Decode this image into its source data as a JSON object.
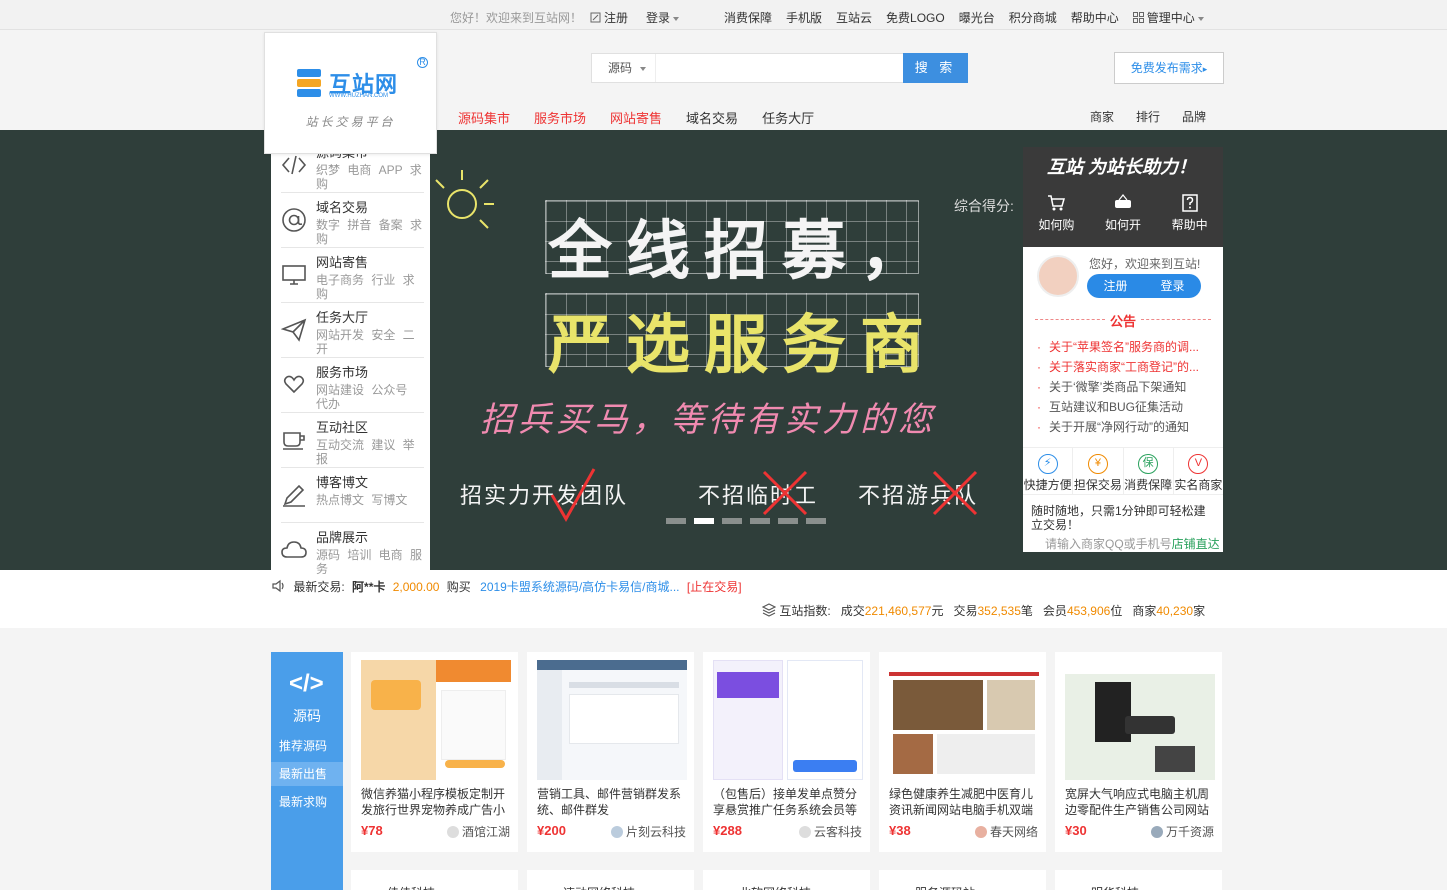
{
  "topbar": {
    "welcome": "您好！欢迎来到互站网！",
    "register": "注册",
    "login": "登录",
    "links": [
      "消费保障",
      "手机版",
      "互站云",
      "免费LOGO",
      "曝光台",
      "积分商城",
      "帮助中心",
      "管理中心"
    ]
  },
  "logo": {
    "name": "互站网",
    "url": "WWW.HUZHAN.COM",
    "reg": "R",
    "slogan": "站长交易平台"
  },
  "search": {
    "type": "源码",
    "placeholder": "",
    "button": "搜 索"
  },
  "publish_button": "免费发布需求",
  "mainnav": [
    "源码集市",
    "服务市场",
    "网站寄售",
    "域名交易",
    "任务大厅"
  ],
  "subnav": [
    "商家",
    "排行",
    "品牌"
  ],
  "categories": [
    {
      "title": "源码集市",
      "tags": "织梦 电商 APP 求购",
      "icon": "code-icon"
    },
    {
      "title": "域名交易",
      "tags": "数字 拼音 备案 求购",
      "icon": "at-icon"
    },
    {
      "title": "网站寄售",
      "tags": "电子商务 行业 求购",
      "icon": "monitor-icon"
    },
    {
      "title": "任务大厅",
      "tags": "网站开发 安全 二开",
      "icon": "paper-plane-icon"
    },
    {
      "title": "服务市场",
      "tags": "网站建设 公众号 代办",
      "icon": "heart-hands-icon"
    },
    {
      "title": "互动社区",
      "tags": "互动交流 建议 举报",
      "icon": "cup-icon"
    },
    {
      "title": "博客博文",
      "tags": "热点博文 写博文",
      "icon": "pen-icon"
    },
    {
      "title": "品牌展示",
      "tags": "源码 培训 电商 服务",
      "icon": "cloud-icon"
    }
  ],
  "banner": {
    "line1": "全线招募，",
    "line2": "严选服务商",
    "line3": "招兵买马，等待有实力的您",
    "items": [
      "招实力开发团队",
      "不招临时工",
      "不招游兵队"
    ],
    "score_label": "综合得分:",
    "dots": 6,
    "active_dot": 1
  },
  "rpanel": {
    "slogan": "互站 为站长助力！",
    "links": [
      "如何购",
      "如何开",
      "帮助中"
    ],
    "hello": "您好，欢迎来到互站!",
    "register": "注册",
    "login": "登录",
    "notice_title": "公告",
    "notices": [
      {
        "text": "关于“苹果签名”服务商的调...",
        "hot": true
      },
      {
        "text": "关于落实商家“工商登记”的...",
        "hot": true
      },
      {
        "text": "关于‘微擎’类商品下架通知",
        "hot": false
      },
      {
        "text": "互站建议和BUG征集活动",
        "hot": false
      },
      {
        "text": "关于开展“净网行动”的通知",
        "hot": false
      }
    ],
    "services": [
      {
        "label": "快捷方便",
        "glyph": "⚡",
        "color": "#2d8ee8"
      },
      {
        "label": "担保交易",
        "glyph": "¥",
        "color": "#f08a00"
      },
      {
        "label": "消费保障",
        "glyph": "保",
        "color": "#2aa15d"
      },
      {
        "label": "实名商家",
        "glyph": "V",
        "color": "#e33"
      }
    ],
    "desc": "随时随地，只需1分钟即可轻松建立交易！",
    "desc2_a": "请输入商家QQ或手机号",
    "desc2_b": "店铺直达"
  },
  "ticker": {
    "label": "最新交易:",
    "buyer": "阿**卡",
    "price": "2,000.00",
    "action": "购买",
    "item": "2019卡盟系统源码/高仿卡易信/商城...",
    "status": "[止在交易]",
    "index_label": "互站指数:",
    "deals_label": "成交",
    "deals": "221,460,577",
    "deals_unit": "元",
    "trades_label": "交易",
    "trades": "352,535",
    "trades_unit": "笔",
    "members_label": "会员",
    "members": "453,906",
    "members_unit": "位",
    "shops_label": "商家",
    "shops": "40,230",
    "shops_unit": "家"
  },
  "side_card": {
    "title": "源码",
    "links": [
      "推荐源码",
      "最新出售",
      "最新求购"
    ],
    "active": 1
  },
  "products": [
    {
      "name": "微信养猫小程序模板定制开发旅行世界宠物养成广告小",
      "price": "¥78",
      "shop": "酒馆江湖"
    },
    {
      "name": "营销工具、邮件营销群发系统、邮件群发",
      "price": "¥200",
      "shop": "片刻云科技"
    },
    {
      "name": "（包售后）接单发单点赞分享悬赏推广任务系统会员等",
      "price": "¥288",
      "shop": "云客科技"
    },
    {
      "name": "绿色健康养生减肥中医育儿资讯新闻网站电脑手机双端",
      "price": "¥38",
      "shop": "春天网络"
    },
    {
      "name": "宽屏大气响应式电脑主机周边零配件生产销售公司网站",
      "price": "¥30",
      "shop": "万千资源"
    }
  ],
  "row2": [
    "佳佳科技",
    "速动网络科技",
    "北软网络科技",
    "服务源码站",
    "明华科技"
  ]
}
